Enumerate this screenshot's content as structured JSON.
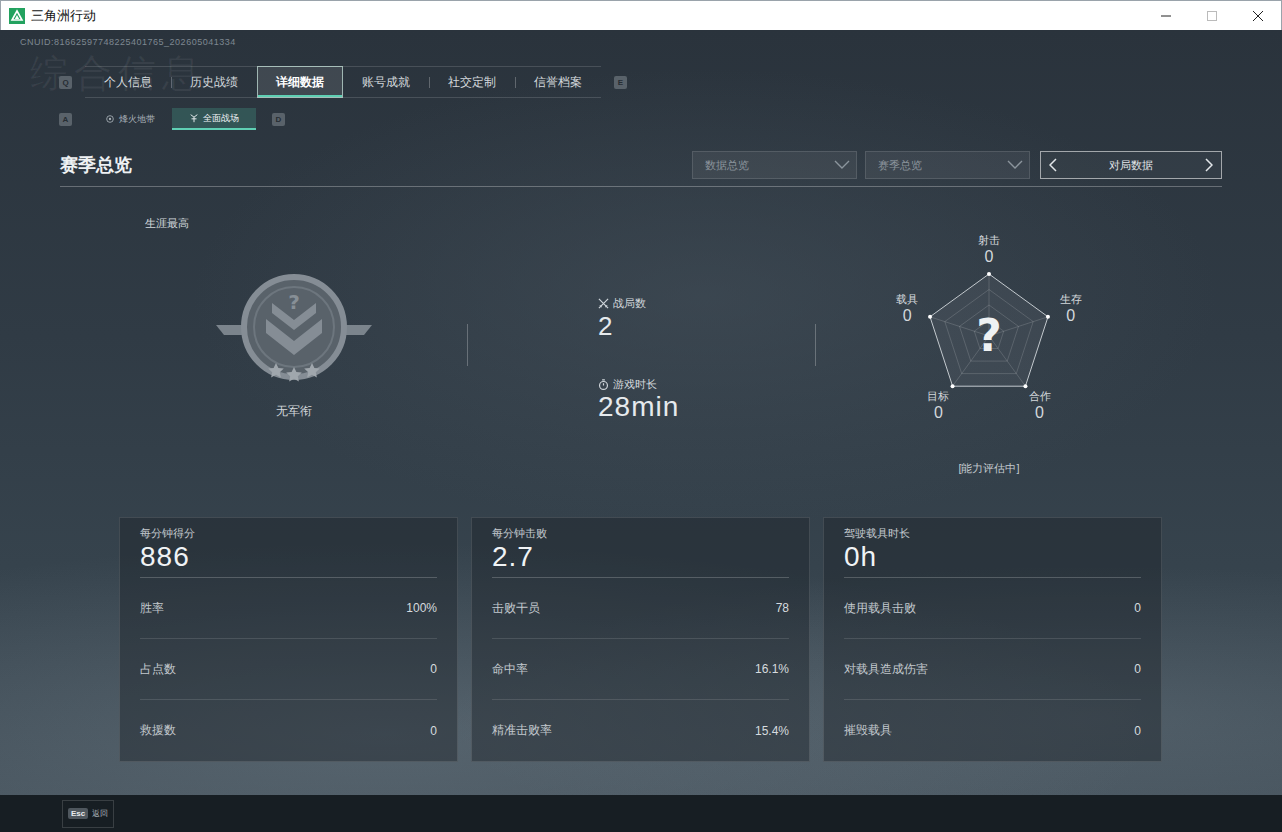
{
  "window": {
    "title": "三角洲行动"
  },
  "uid": "CNUID:81662597748225401765_202605041334",
  "watermark": "综合信息",
  "tabs": {
    "prev_key": "Q",
    "next_key": "E",
    "items": [
      {
        "label": "个人信息",
        "selected": false
      },
      {
        "label": "历史战绩",
        "selected": false
      },
      {
        "label": "详细数据",
        "selected": true
      },
      {
        "label": "账号成就",
        "selected": false
      },
      {
        "label": "社交定制",
        "selected": false
      },
      {
        "label": "信誉档案",
        "selected": false
      }
    ]
  },
  "subtabs": {
    "prev_key": "A",
    "next_key": "D",
    "items": [
      {
        "label": "烽火地带",
        "selected": false
      },
      {
        "label": "全面战场",
        "selected": true
      }
    ]
  },
  "section": {
    "title": "赛季总览",
    "filters": [
      {
        "label": "数据总览"
      },
      {
        "label": "赛季总览"
      }
    ],
    "switcher": {
      "label": "对局数据"
    }
  },
  "career": {
    "label": "生涯最高",
    "emblem_mark": "?",
    "rank": "无军衔"
  },
  "summary": [
    {
      "label": "战局数",
      "value": "2"
    },
    {
      "label": "游戏时长",
      "value": "28min"
    }
  ],
  "radar": {
    "center_mark": "?",
    "status": "[能力评估中]",
    "axes": [
      {
        "label": "射击",
        "value": "0",
        "level": 0
      },
      {
        "label": "生存",
        "value": "0",
        "level": 0
      },
      {
        "label": "合作",
        "value": "0",
        "level": 0
      },
      {
        "label": "目标",
        "value": "0",
        "level": 0
      },
      {
        "label": "载具",
        "value": "0",
        "level": 0
      }
    ]
  },
  "cards": [
    {
      "title": "每分钟得分",
      "value": "886",
      "rows": [
        {
          "label": "胜率",
          "value": "100%"
        },
        {
          "label": "占点数",
          "value": "0"
        },
        {
          "label": "救援数",
          "value": "0"
        }
      ]
    },
    {
      "title": "每分钟击败",
      "value": "2.7",
      "rows": [
        {
          "label": "击败干员",
          "value": "78"
        },
        {
          "label": "命中率",
          "value": "16.1%"
        },
        {
          "label": "精准击败率",
          "value": "15.4%"
        }
      ]
    },
    {
      "title": "驾驶载具时长",
      "value": "0h",
      "rows": [
        {
          "label": "使用载具击败",
          "value": "0"
        },
        {
          "label": "对载具造成伤害",
          "value": "0"
        },
        {
          "label": "摧毁载具",
          "value": "0"
        }
      ]
    }
  ],
  "footer": {
    "key": "Esc",
    "label": "返回"
  }
}
